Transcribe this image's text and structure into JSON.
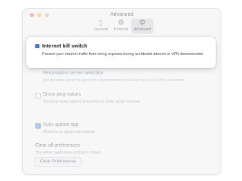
{
  "window": {
    "title": "Advanced"
  },
  "tabs": [
    {
      "label": "General",
      "icon": "phone-icon"
    },
    {
      "label": "Protocol",
      "icon": "gear-icon"
    },
    {
      "label": "Advanced",
      "icon": "gears-icon",
      "selected": true
    }
  ],
  "settings": {
    "kill_switch": {
      "title": "Internet kill switch",
      "description": "Prevent your internet traffic from being exposed during accidental internet or VPN disconnection",
      "checked": true
    },
    "personalize": {
      "title": "Personalize server selection",
      "description": "Use the same server that gave you a good experience last time for all your VPN connections"
    },
    "ping": {
      "title": "Show ping values",
      "description": "View ping values against all locations for better server selection",
      "checked": false
    },
    "auto_update": {
      "title": "Auto-update app",
      "description": "Check for an update automatically",
      "checked": true
    },
    "clear": {
      "title": "Clear all preferences",
      "description": "This will set applications settings to default.",
      "button_label": "Clear Preferences"
    }
  },
  "colors": {
    "accent": "#2f6fdc"
  }
}
